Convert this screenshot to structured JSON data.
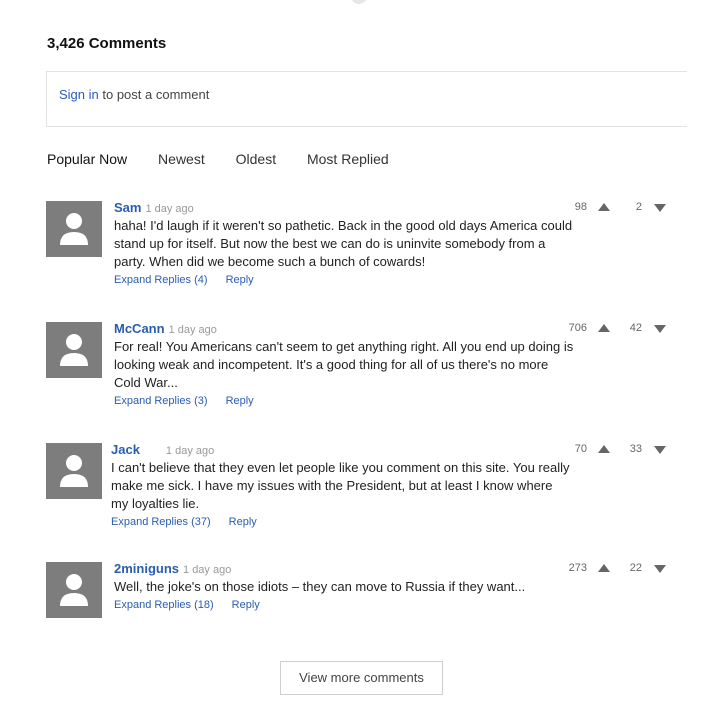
{
  "header": {
    "comment_count": "3,426 Comments"
  },
  "signin": {
    "link_text": "Sign in",
    "rest_text": " to post a comment"
  },
  "sort_tabs": [
    "Popular Now",
    "Newest",
    "Oldest",
    "Most Replied"
  ],
  "comments": [
    {
      "author": "Sam",
      "time": "1 day ago",
      "text": "haha! I'd laugh if it weren't so pathetic. Back in the good old days America could stand up for itself. But now the best we can do is uninvite somebody from a party. When did we become such a bunch of cowards!",
      "expand": "Expand Replies (4)",
      "reply": "Reply",
      "upvotes": "98",
      "downvotes": "2"
    },
    {
      "author": "McCann",
      "time": "1 day ago",
      "text": "For real! You Americans can't seem to get anything right. All you end up doing is looking weak and incompetent. It's a good thing for all of us there's no more Cold War...",
      "expand": "Expand Replies (3)",
      "reply": "Reply",
      "upvotes": "706",
      "downvotes": "42"
    },
    {
      "author": "Jack",
      "time": "1 day ago",
      "text": "I can't believe that they even let people like you comment on this site. You really make me sick. I have my issues with the President, but at least I know where my loyalties lie.",
      "expand": "Expand Replies (37)",
      "reply": "Reply",
      "upvotes": "70",
      "downvotes": "33"
    },
    {
      "author": "2miniguns",
      "time": "1 day ago",
      "text": "Well, the joke's on those idiots – they can move to Russia if they want...",
      "expand": "Expand Replies (18)",
      "reply": "Reply",
      "upvotes": "273",
      "downvotes": "22"
    }
  ],
  "view_more": "View more comments"
}
